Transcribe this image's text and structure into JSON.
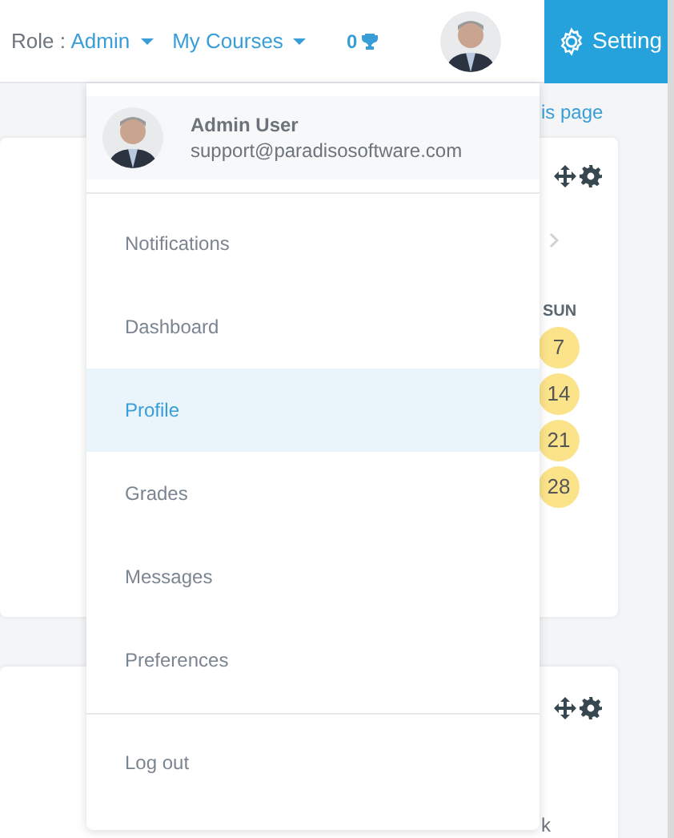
{
  "header": {
    "role_label": "Role :",
    "role_value": "Admin",
    "courses_menu": "My Courses",
    "trophy_count": "0",
    "settings_button": "Setting"
  },
  "page_link": "is page",
  "calendar": {
    "weekday": "SUN",
    "days": [
      {
        "label": "7",
        "highlighted": true
      },
      {
        "label": "14",
        "highlighted": true
      },
      {
        "label": "21",
        "highlighted": true
      },
      {
        "label": "28",
        "highlighted": true
      }
    ]
  },
  "second_card": {
    "text_fragment": "k"
  },
  "user_menu": {
    "name": "Admin User",
    "email": "support@paradisosoftware.com",
    "items": [
      {
        "label": "Notifications",
        "selected": false
      },
      {
        "label": "Dashboard",
        "selected": false
      },
      {
        "label": "Profile",
        "selected": true
      },
      {
        "label": "Grades",
        "selected": false
      },
      {
        "label": "Messages",
        "selected": false
      },
      {
        "label": "Preferences",
        "selected": false
      }
    ],
    "logout": "Log out"
  }
}
